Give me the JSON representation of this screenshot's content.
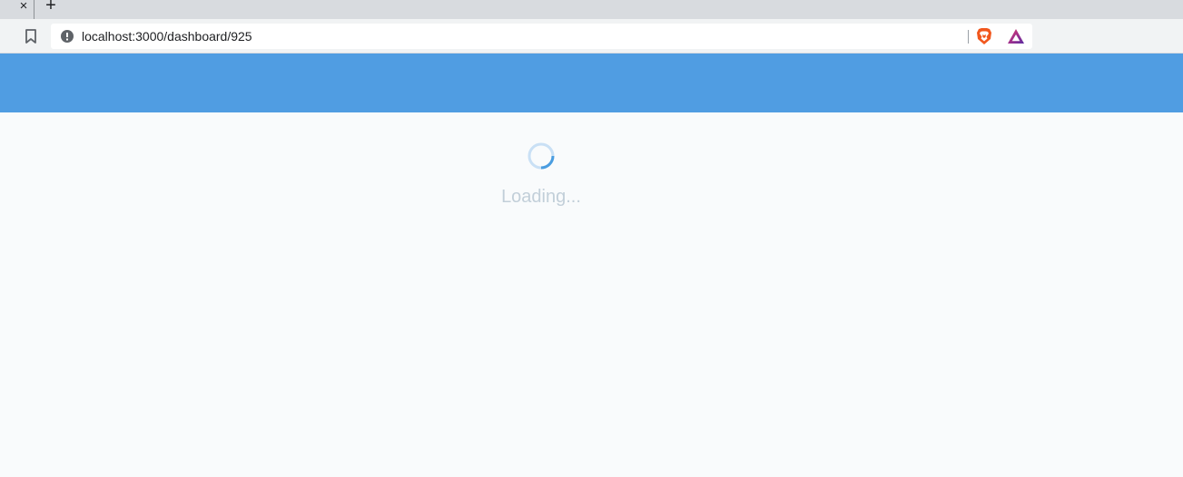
{
  "browser": {
    "tab_close_glyph": "×",
    "new_tab_glyph": "+",
    "url": "localhost:3000/dashboard/925",
    "icons": {
      "bookmark": "bookmark-icon",
      "site_info": "info-icon",
      "brave_shields": "brave-lion-icon",
      "brave_rewards": "rewards-triangle-icon"
    }
  },
  "app": {
    "header_color": "#509de2",
    "background_color": "#f9fbfc"
  },
  "main": {
    "loading_text": "Loading...",
    "spinner_icon": "loading-spinner-icon",
    "spinner_color": "#4a9de0"
  }
}
